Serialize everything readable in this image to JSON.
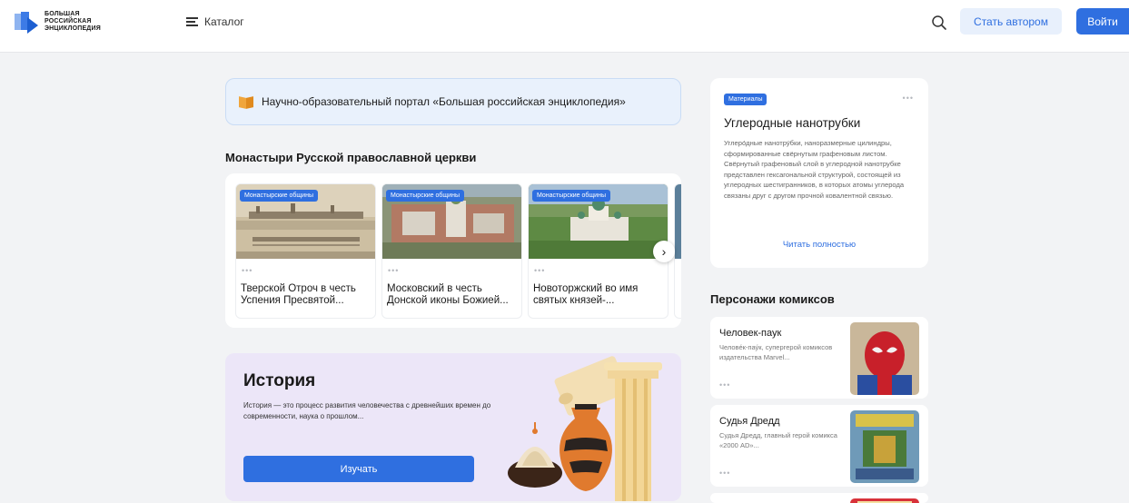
{
  "header": {
    "logo_lines": [
      "БОЛЬШАЯ",
      "РОССИЙСКАЯ",
      "ЭНЦИКЛОПЕДИЯ"
    ],
    "catalog_label": "Каталог",
    "become_author_label": "Стать автором",
    "login_label": "Войти"
  },
  "banner": {
    "text": "Научно-образовательный портал «Большая российская энциклопедия»"
  },
  "monasteries": {
    "title": "Монастыри Русской православной церкви",
    "cards": [
      {
        "tag": "Монастырские общины",
        "dots": "•••",
        "title": "Тверской Отроч в честь Успения Пресвятой..."
      },
      {
        "tag": "Монастырские общины",
        "dots": "•••",
        "title": "Московский в честь Донской иконы Божией..."
      },
      {
        "tag": "Монастырские общины",
        "dots": "•••",
        "title": "Новоторжский во имя святых князей-..."
      }
    ],
    "next_arrow": "›"
  },
  "history": {
    "title": "История",
    "description": "История — это процесс развития человечества с древнейших времен до современности, наука о прошлом...",
    "button_label": "Изучать"
  },
  "article": {
    "tag": "Материалы",
    "dots": "•••",
    "title": "Углеродные нанотрубки",
    "text": "Углеро́дные нанотру́бки, наноразмерные цилиндры, сформированные свёрнутым графеновым листом. Свёрнутый графеновый слой в углеродной нанотрубке представлен гексагональной структурой, состоящей из углеродных шестигранников, в которых атомы углерода связаны друг с другом прочной ковалентной связью.",
    "read_more": "Читать полностью"
  },
  "comics": {
    "title": "Персонажи комиксов",
    "cards": [
      {
        "title": "Человек-паук",
        "description": "Челове́к-пау́к, супергерой комиксов издательства Marvel...",
        "dots": "•••"
      },
      {
        "title": "Судья Дредд",
        "description": "Судья Дредд, главный герой комикса «2000 AD»...",
        "dots": "•••"
      }
    ]
  },
  "colors": {
    "accent": "#2f6fe0",
    "background": "#f2f3f5",
    "history_bg": "#ece6f8"
  }
}
